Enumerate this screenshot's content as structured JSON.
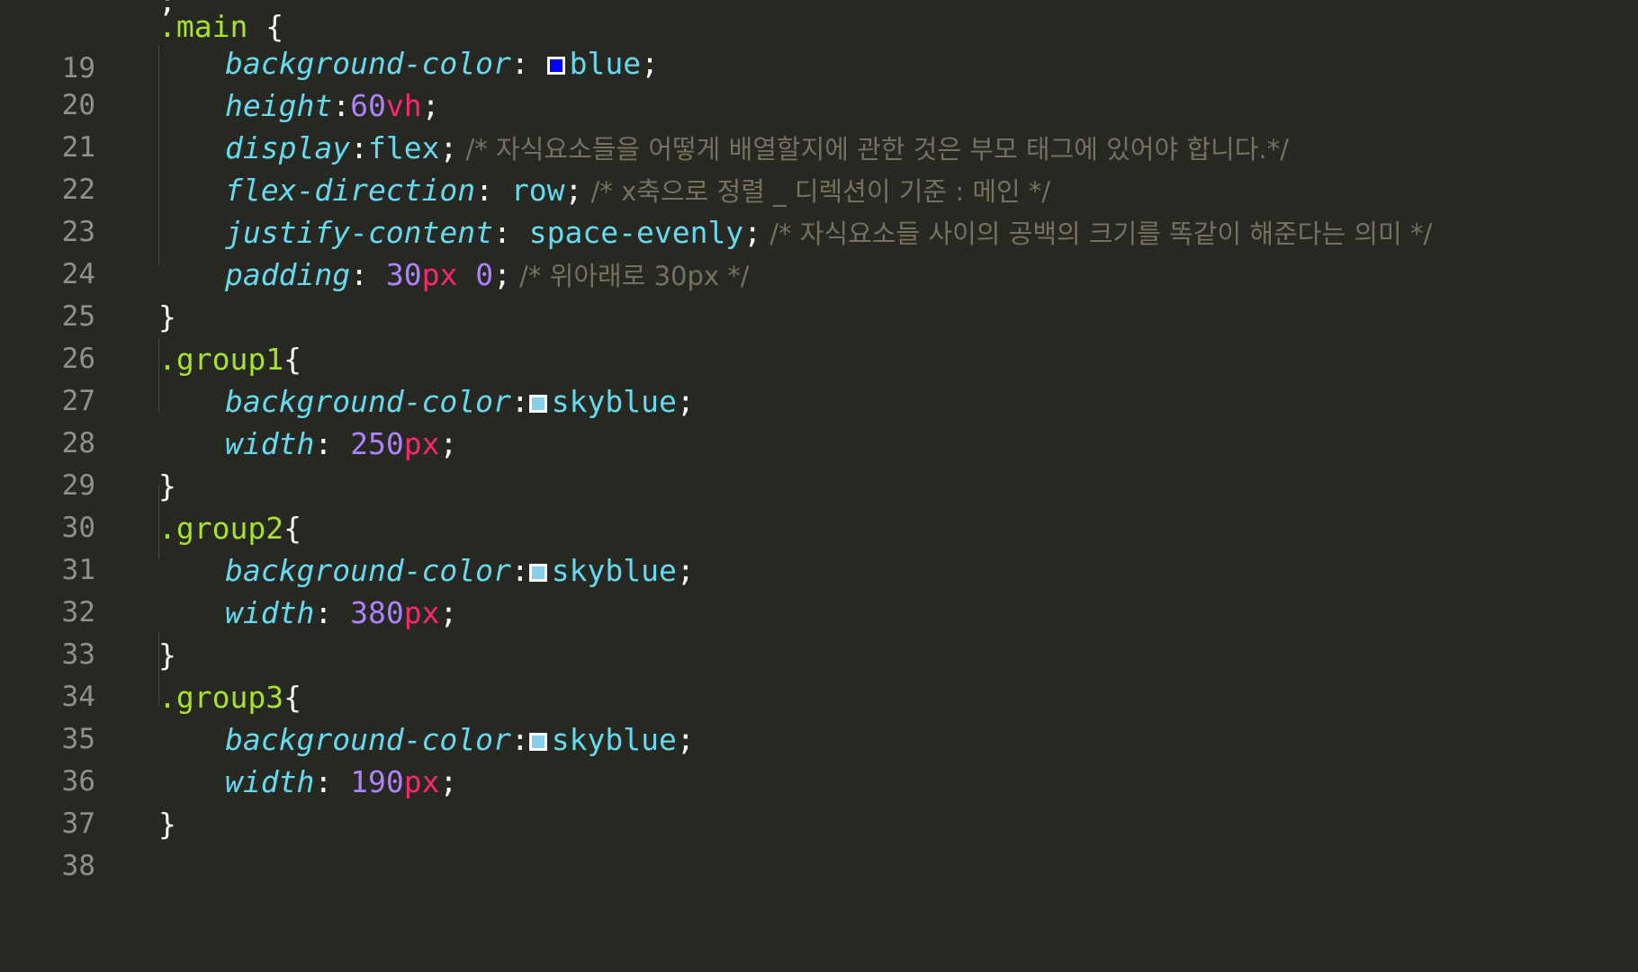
{
  "colors": {
    "background": "#272822",
    "gutter_text": "#90908a",
    "selector": "#a6e22e",
    "property": "#66d9ef",
    "number": "#ae81ff",
    "unit": "#f92672",
    "comment": "#75715e",
    "swatch_blue": "#0000ff",
    "swatch_skyblue": "#87ceeb"
  },
  "editor": {
    "top_fragment": ";",
    "lines": [
      {
        "num": "19",
        "selector": ".main",
        "brace": " {"
      },
      {
        "num": "20",
        "prop": "background-color",
        "sep": ": ",
        "value": "blue",
        "end": ";"
      },
      {
        "num": "21",
        "prop": "height",
        "sep": ":",
        "number": "60",
        "unit": "vh",
        "end": ";"
      },
      {
        "num": "22",
        "prop": "display",
        "sep": ":",
        "value": "flex",
        "end": ";",
        "comment": " /* 자식요소들을 어떻게 배열할지에 관한 것은 부모 태그에 있어야 합니다.*/"
      },
      {
        "num": "23",
        "prop": "flex-direction",
        "sep": ": ",
        "value": "row",
        "end": ";",
        "comment": " /* x축으로 정렬 _ 디렉션이 기준 : 메인 */"
      },
      {
        "num": "24",
        "prop": "justify-content",
        "sep": ": ",
        "value": "space-evenly",
        "end": ";",
        "comment": " /* 자식요소들 사이의 공백의 크기를 똑같이 해준다는 의미 */"
      },
      {
        "num": "25",
        "prop": "padding",
        "sep": ": ",
        "number": "30",
        "unit": "px",
        "number2": " 0",
        "end": ";",
        "comment": " /* 위아래로 30px */"
      },
      {
        "num": "26",
        "brace": "}"
      },
      {
        "num": "27",
        "selector": ".group1",
        "brace": "{"
      },
      {
        "num": "28",
        "prop": "background-color",
        "sep": ":",
        "value": "skyblue",
        "end": ";"
      },
      {
        "num": "29",
        "prop": "width",
        "sep": ": ",
        "number": "250",
        "unit": "px",
        "end": ";"
      },
      {
        "num": "30",
        "brace": "}"
      },
      {
        "num": "31",
        "selector": ".group2",
        "brace": "{"
      },
      {
        "num": "32",
        "prop": "background-color",
        "sep": ":",
        "value": "skyblue",
        "end": ";"
      },
      {
        "num": "33",
        "prop": "width",
        "sep": ": ",
        "number": "380",
        "unit": "px",
        "end": ";"
      },
      {
        "num": "34",
        "brace": "}"
      },
      {
        "num": "35",
        "selector": ".group3",
        "brace": "{"
      },
      {
        "num": "36",
        "prop": "background-color",
        "sep": ":",
        "value": "skyblue",
        "end": ";"
      },
      {
        "num": "37",
        "prop": "width",
        "sep": ": ",
        "number": "190",
        "unit": "px",
        "end": ";"
      },
      {
        "num": "38",
        "brace": "}"
      }
    ]
  }
}
